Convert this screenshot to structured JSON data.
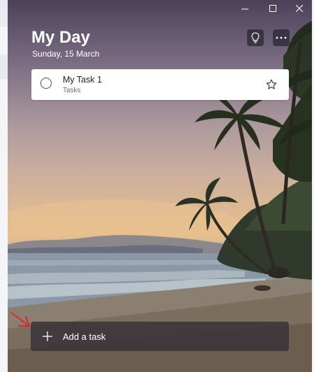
{
  "window": {
    "minimize_icon": "minimize-icon",
    "maximize_icon": "maximize-icon",
    "close_icon": "close-icon"
  },
  "header": {
    "title": "My Day",
    "date": "Sunday, 15 March",
    "suggestions_icon": "lightbulb-icon",
    "more_icon": "more-options-icon"
  },
  "tasks": [
    {
      "title": "My Task 1",
      "list": "Tasks",
      "completed": false,
      "important": false
    }
  ],
  "add_task": {
    "label": "Add a task",
    "icon": "plus-icon"
  },
  "annotation": {
    "color": "#d9282f",
    "icon": "arrow-icon"
  }
}
